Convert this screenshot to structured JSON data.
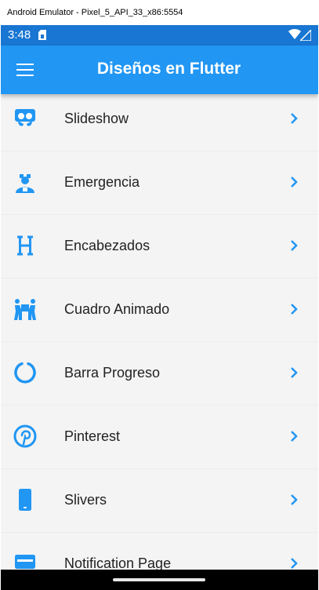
{
  "window": {
    "title": "Android Emulator - Pixel_5_API_33_x86:5554"
  },
  "status_bar": {
    "time": "3:48"
  },
  "app_bar": {
    "title": "Diseños en Flutter"
  },
  "colors": {
    "accent": "#2196f3",
    "status": "#1976d2",
    "background": "#f4f4f4"
  },
  "menu": [
    {
      "label": "Slideshow",
      "icon": "slideshare-icon"
    },
    {
      "label": "Emergencia",
      "icon": "ambulance-worker-icon"
    },
    {
      "label": "Encabezados",
      "icon": "heading-icon"
    },
    {
      "label": "Cuadro Animado",
      "icon": "people-carry-icon"
    },
    {
      "label": "Barra Progreso",
      "icon": "circle-notch-icon"
    },
    {
      "label": "Pinterest",
      "icon": "pinterest-icon"
    },
    {
      "label": "Slivers",
      "icon": "mobile-phone-icon"
    },
    {
      "label": "Notification Page",
      "icon": "notification-icon"
    }
  ]
}
